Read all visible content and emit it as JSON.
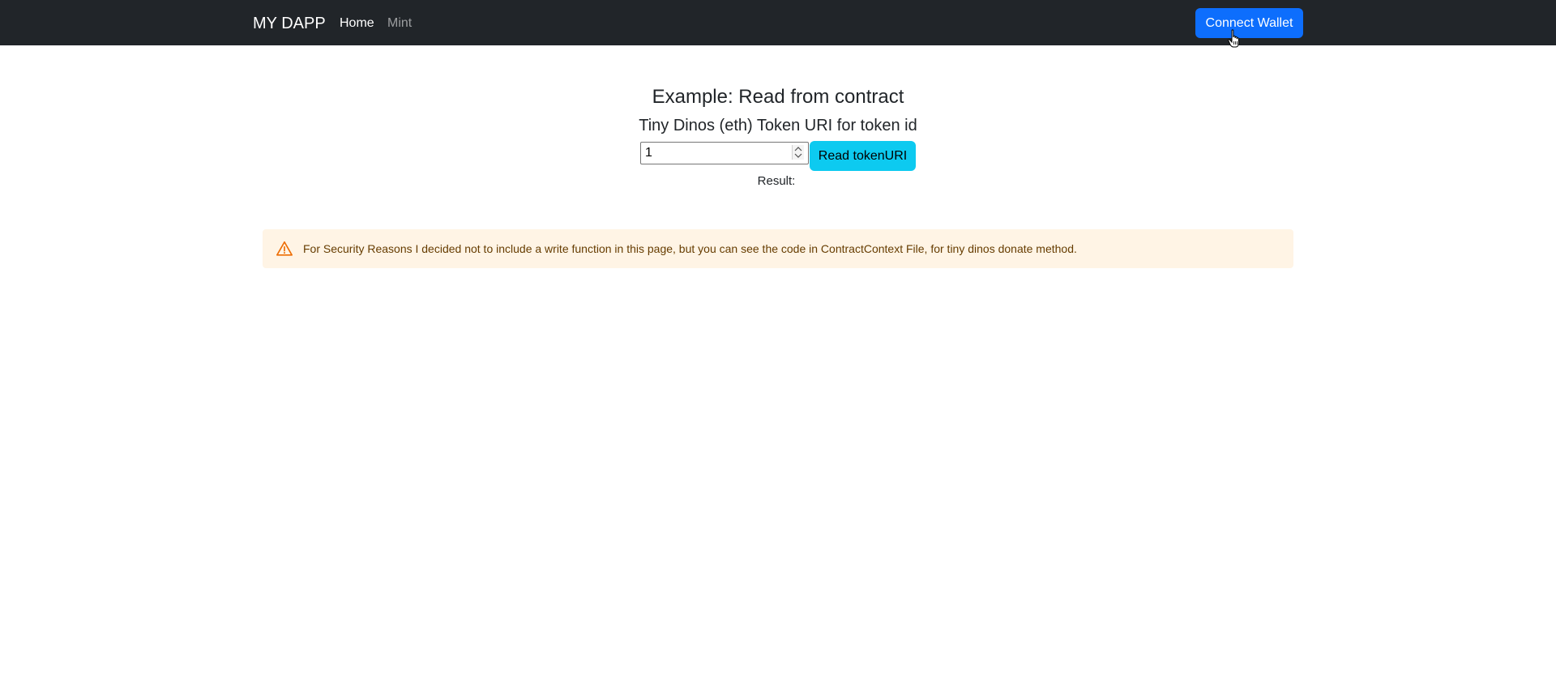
{
  "navbar": {
    "brand": "MY DAPP",
    "links": [
      {
        "label": "Home",
        "active": true
      },
      {
        "label": "Mint",
        "active": false
      }
    ],
    "connect_label": "Connect Wallet"
  },
  "main": {
    "title": "Example: Read from contract",
    "subtitle": "Tiny Dinos (eth) Token URI for token id",
    "token_input": {
      "value": "1",
      "placeholder": ""
    },
    "read_button_label": "Read tokenURI",
    "result_label": "Result:",
    "result_value": ""
  },
  "alert": {
    "icon": "warning-triangle-icon",
    "text": "For Security Reasons I decided not to include a write function in this page, but you can see the code in ContractContext File, for tiny dinos donate method."
  },
  "colors": {
    "navbar_bg": "#212529",
    "primary": "#0d6efd",
    "info": "#0dcaf0",
    "warning_bg": "#fff4e5",
    "warning_text": "#663c00",
    "warning_icon": "#ed6c02"
  }
}
